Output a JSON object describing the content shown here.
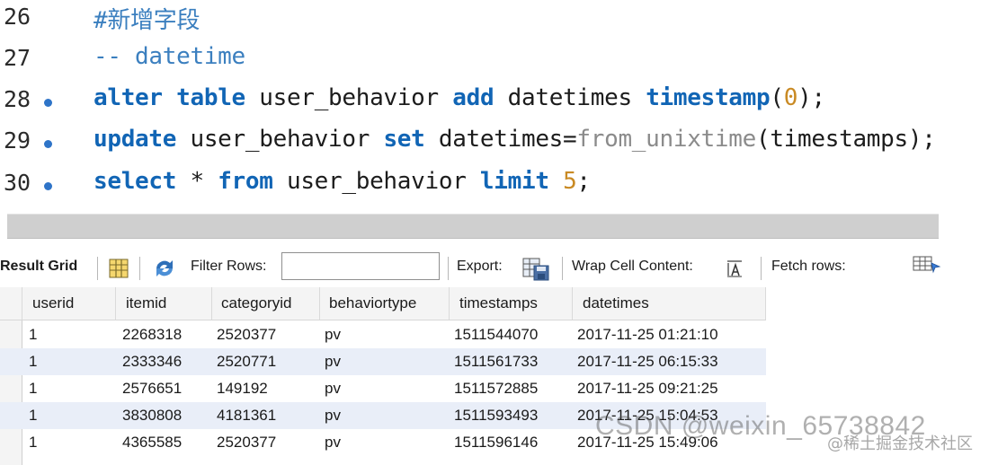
{
  "editor": {
    "lines": [
      {
        "num": "26",
        "breakpoint": false,
        "tokens": [
          {
            "t": "#新增字段",
            "c": "cm"
          }
        ]
      },
      {
        "num": "27",
        "breakpoint": false,
        "tokens": [
          {
            "t": "-- datetime",
            "c": "cm"
          }
        ]
      },
      {
        "num": "28",
        "breakpoint": true,
        "tokens": [
          {
            "t": "alter",
            "c": "kw"
          },
          {
            "t": " ",
            "c": "id"
          },
          {
            "t": "table",
            "c": "kw"
          },
          {
            "t": " user_behavior ",
            "c": "id"
          },
          {
            "t": "add",
            "c": "kw"
          },
          {
            "t": " datetimes ",
            "c": "id"
          },
          {
            "t": "timestamp",
            "c": "kw"
          },
          {
            "t": "(",
            "c": "id"
          },
          {
            "t": "0",
            "c": "nm"
          },
          {
            "t": ");",
            "c": "id"
          }
        ]
      },
      {
        "num": "29",
        "breakpoint": true,
        "tokens": [
          {
            "t": "update",
            "c": "kw"
          },
          {
            "t": " user_behavior ",
            "c": "id"
          },
          {
            "t": "set",
            "c": "kw"
          },
          {
            "t": " datetimes=",
            "c": "id"
          },
          {
            "t": "from_unixtime",
            "c": "fn"
          },
          {
            "t": "(timestamps);",
            "c": "id"
          }
        ]
      },
      {
        "num": "30",
        "breakpoint": true,
        "tokens": [
          {
            "t": "select",
            "c": "kw"
          },
          {
            "t": " * ",
            "c": "id"
          },
          {
            "t": "from",
            "c": "kw"
          },
          {
            "t": " user_behavior ",
            "c": "id"
          },
          {
            "t": "limit",
            "c": "kw"
          },
          {
            "t": " ",
            "c": "id"
          },
          {
            "t": "5",
            "c": "nm"
          },
          {
            "t": ";",
            "c": "id"
          }
        ]
      }
    ]
  },
  "toolbar": {
    "result_grid_label": "Result Grid",
    "filter_rows_label": "Filter Rows:",
    "filter_input_value": "",
    "export_label": "Export:",
    "wrap_label": "Wrap Cell Content:",
    "fetch_label": "Fetch rows:"
  },
  "grid": {
    "columns": [
      "userid",
      "itemid",
      "categoryid",
      "behaviortype",
      "timestamps",
      "datetimes"
    ],
    "rows": [
      [
        "1",
        "2268318",
        "2520377",
        "pv",
        "1511544070",
        "2017-11-25 01:21:10"
      ],
      [
        "1",
        "2333346",
        "2520771",
        "pv",
        "1511561733",
        "2017-11-25 06:15:33"
      ],
      [
        "1",
        "2576651",
        "149192",
        "pv",
        "1511572885",
        "2017-11-25 09:21:25"
      ],
      [
        "1",
        "3830808",
        "4181361",
        "pv",
        "1511593493",
        "2017-11-25 15:04:53"
      ],
      [
        "1",
        "4365585",
        "2520377",
        "pv",
        "1511596146",
        "2017-11-25 15:49:06"
      ]
    ]
  },
  "watermark": {
    "text": "CSDN @weixin_65738842",
    "small": "@稀土掘金技术社区"
  },
  "colors": {
    "keyword": "#1165b5",
    "comment": "#3b7fbf",
    "function": "#8b8b8b",
    "number": "#c98a24",
    "breakpoint": "#2e74c8",
    "alt_row": "#e9eef8"
  }
}
